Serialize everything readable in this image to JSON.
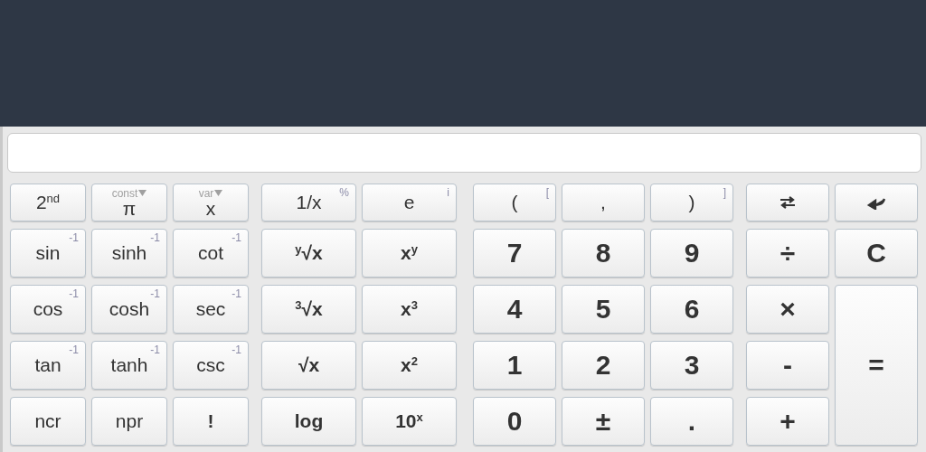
{
  "keys": [
    [
      {
        "kind": "fn",
        "label": "2$^{nd}$"
      },
      {
        "kind": "menu",
        "label": "π",
        "alt": "const"
      },
      {
        "kind": "menu",
        "label": "x",
        "alt": "var"
      },
      {
        "kind": "fn",
        "label": "1/x",
        "alt": "%"
      },
      {
        "kind": "fn",
        "label": "e",
        "alt": "i"
      },
      {
        "kind": "fn",
        "label": "(",
        "alt": "["
      },
      {
        "kind": "fn",
        "label": ","
      },
      {
        "kind": "fn",
        "label": ")",
        "alt": "]"
      },
      {
        "kind": "swap"
      },
      {
        "kind": "enter"
      }
    ],
    [
      {
        "kind": "fn",
        "label": "sin",
        "alt": "-1"
      },
      {
        "kind": "fn",
        "label": "sinh",
        "alt": "-1"
      },
      {
        "kind": "fn",
        "label": "cot",
        "alt": "-1"
      },
      {
        "kind": "bold",
        "label": "$^{y}$√x"
      },
      {
        "kind": "bold",
        "label": "x$^{y}$"
      },
      {
        "kind": "digit",
        "label": "7"
      },
      {
        "kind": "digit",
        "label": "8"
      },
      {
        "kind": "digit",
        "label": "9"
      },
      {
        "kind": "digit",
        "label": "÷"
      },
      {
        "kind": "digit",
        "label": "C"
      }
    ],
    [
      {
        "kind": "fn",
        "label": "cos",
        "alt": "-1"
      },
      {
        "kind": "fn",
        "label": "cosh",
        "alt": "-1"
      },
      {
        "kind": "fn",
        "label": "sec",
        "alt": "-1"
      },
      {
        "kind": "bold",
        "label": "$^{3}$√x"
      },
      {
        "kind": "bold",
        "label": "x$^{3}$"
      },
      {
        "kind": "digit",
        "label": "4"
      },
      {
        "kind": "digit",
        "label": "5"
      },
      {
        "kind": "digit",
        "label": "6"
      },
      {
        "kind": "digit",
        "label": "×"
      },
      {
        "kind": "tall",
        "label": "="
      }
    ],
    [
      {
        "kind": "fn",
        "label": "tan",
        "alt": "-1"
      },
      {
        "kind": "fn",
        "label": "tanh",
        "alt": "-1"
      },
      {
        "kind": "fn",
        "label": "csc",
        "alt": "-1"
      },
      {
        "kind": "bold",
        "label": "√x"
      },
      {
        "kind": "bold",
        "label": "x$^{2}$"
      },
      {
        "kind": "digit",
        "label": "1"
      },
      {
        "kind": "digit",
        "label": "2"
      },
      {
        "kind": "digit",
        "label": "3"
      },
      {
        "kind": "digit",
        "label": "-"
      }
    ],
    [
      {
        "kind": "fn",
        "label": "ncr"
      },
      {
        "kind": "fn",
        "label": "npr"
      },
      {
        "kind": "bold",
        "label": "!"
      },
      {
        "kind": "bold",
        "label": "log"
      },
      {
        "kind": "bold",
        "label": "10$^{x}$"
      },
      {
        "kind": "digit",
        "label": "0"
      },
      {
        "kind": "digit",
        "label": "±"
      },
      {
        "kind": "digit",
        "label": "."
      },
      {
        "kind": "digit",
        "label": "+"
      }
    ]
  ]
}
